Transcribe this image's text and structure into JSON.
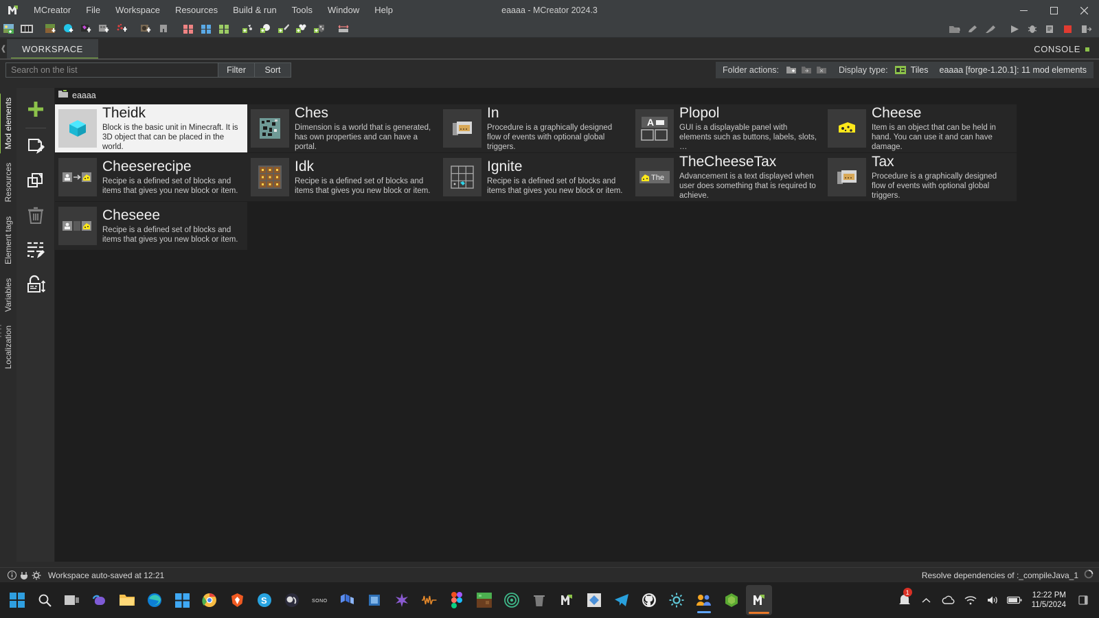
{
  "window": {
    "app_name": "MCreator",
    "title": "eaaaa - MCreator 2024.3",
    "menus": [
      "File",
      "Workspace",
      "Resources",
      "Build & run",
      "Tools",
      "Window",
      "Help"
    ],
    "controls": {
      "minimize": "minimize-button",
      "maximize": "maximize-button",
      "close": "close-button"
    }
  },
  "toolbar": {
    "left_icons": [
      "new-mod-element-icon",
      "film-strip-icon",
      "new-block-icon",
      "new-fluid-icon",
      "new-item-icon",
      "new-structure-icon",
      "new-particle-icon",
      "new-gui-icon",
      "new-armor-icon",
      "tag-red-icon",
      "tag-blue-icon",
      "tag-green-icon",
      "new-plant-icon",
      "new-food-icon",
      "new-tool-icon",
      "new-mob-icon",
      "new-ore-icon",
      "resize-icon"
    ],
    "right_icons": [
      "open-folder-icon",
      "pencil-icon",
      "hammer-icon",
      "run-client-icon",
      "debug-icon",
      "build-log-icon",
      "stop-icon",
      "export-icon"
    ]
  },
  "tabs": {
    "workspace_label": "WORKSPACE",
    "console_label": "CONSOLE",
    "left_arrow": "chevron-left-icon"
  },
  "search": {
    "placeholder": "Search on the list",
    "value": "",
    "filter_label": "Filter",
    "sort_label": "Sort"
  },
  "folder_actions": {
    "label": "Folder actions:",
    "icons": [
      "new-folder-icon",
      "move-folder-icon",
      "delete-folder-icon"
    ]
  },
  "display_type": {
    "label": "Display type:",
    "icon": "tiles-view-icon",
    "value": "Tiles"
  },
  "element_count": "eaaaa [forge-1.20.1]: 11 mod elements",
  "sidebar": {
    "vtabs": [
      {
        "label": "Mod elements",
        "active": true
      },
      {
        "label": "Resources",
        "active": false
      },
      {
        "label": "Element tags",
        "active": false
      },
      {
        "label": "Variables",
        "active": false
      },
      {
        "label": "Localization",
        "active": false
      }
    ],
    "rail": [
      {
        "name": "add-mod-element-button",
        "icon": "plus-icon"
      },
      {
        "name": "edit-mod-element-button",
        "icon": "page-pencil-icon"
      },
      {
        "name": "duplicate-mod-element-button",
        "icon": "copy-icon"
      },
      {
        "name": "delete-mod-element-button",
        "icon": "trash-icon"
      },
      {
        "name": "edit-code-button",
        "icon": "list-pencil-icon"
      },
      {
        "name": "lock-code-button",
        "icon": "lock-arrows-icon"
      }
    ]
  },
  "breadcrumb": {
    "icon": "folder-icon",
    "label": "eaaaa"
  },
  "tiles": [
    {
      "name": "Theidk",
      "description": "Block is the basic unit in Minecraft. It is 3D object that can be placed in the world.",
      "icon": "block-cube-icon",
      "selected": true
    },
    {
      "name": "Ches",
      "description": "Dimension is a world that is generated, has own properties and can have a portal.",
      "icon": "dimension-icon",
      "selected": false
    },
    {
      "name": "In",
      "description": "Procedure is a graphically designed flow of events with optional global triggers.",
      "icon": "procedure-icon",
      "selected": false
    },
    {
      "name": "Plopol",
      "description": "GUI is a displayable panel with elements such as buttons, labels, slots, …",
      "icon": "gui-icon",
      "selected": false
    },
    {
      "name": "Cheese",
      "description": "Item is an object that can be held in hand. You can use it and can have damage.",
      "icon": "cheese-item-icon",
      "selected": false
    },
    {
      "name": "Cheeserecipe",
      "description": "Recipe is a defined set of blocks and items that gives you new block or item.",
      "icon": "smelting-recipe-icon",
      "selected": false
    },
    {
      "name": "Idk",
      "description": "Recipe is a defined set of blocks and items that gives you new block or item.",
      "icon": "crafting-recipe-icon",
      "selected": false
    },
    {
      "name": "Ignite",
      "description": "Recipe is a defined set of blocks and items that gives you new block or item.",
      "icon": "crafting-grid-icon",
      "selected": false
    },
    {
      "name": "TheCheeseTax",
      "description": "Advancement is a text displayed when user does something that is required to achieve.",
      "icon": "advancement-icon",
      "selected": false
    },
    {
      "name": "Tax",
      "description": "Procedure is a graphically designed flow of events with optional global triggers.",
      "icon": "procedure-icon",
      "selected": false
    },
    {
      "name": "Cheseee",
      "description": "Recipe is a defined set of blocks and items that gives you new block or item.",
      "icon": "smelting-recipe-icon",
      "selected": false
    }
  ],
  "status": {
    "text": "Workspace auto-saved at 12:21",
    "right_text": "Resolve dependencies of :_compileJava_1",
    "icons": [
      "info-icon",
      "plug-icon",
      "gear-icon"
    ],
    "right_icon": "progress-icon"
  },
  "taskbar": {
    "apps": [
      "windows-start-icon",
      "search-icon",
      "task-view-icon",
      "copilot-icon",
      "file-explorer-icon",
      "edge-icon",
      "microsoft-store-icon",
      "chrome-icon",
      "brave-icon",
      "skype-icon",
      "obs-icon",
      "sonos-icon",
      "blockbench-icon",
      "vlc-icon",
      "krita-icon",
      "audacity-icon",
      "figma-icon",
      "minecraft-icon",
      "spiral-icon",
      "trash-icon",
      "mcreator-grey-icon",
      "minecraft-launcher-icon",
      "telegram-icon",
      "github-icon",
      "settings-icon",
      "teams-icon",
      "node-icon",
      "mcreator-active-icon"
    ],
    "tray": [
      "chevron-up-icon",
      "cloud-icon",
      "wifi-icon",
      "volume-icon",
      "battery-icon"
    ],
    "notification_count": "1",
    "clock_time": "12:22 PM",
    "clock_date": "11/5/2024"
  },
  "colors": {
    "accent_green": "#8cc24a",
    "titlebar_bg": "#3c3f41",
    "content_bg": "#1e1e1e",
    "tile_bg": "#262626",
    "selected_tile_bg": "#f2f2f2"
  }
}
